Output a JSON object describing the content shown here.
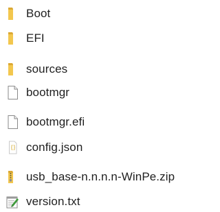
{
  "files": [
    {
      "name": "Boot",
      "icon": "folder-icon"
    },
    {
      "name": "EFI",
      "icon": "folder-icon"
    },
    {
      "name": "sources",
      "icon": "folder-icon"
    },
    {
      "name": "bootmgr",
      "icon": "file-icon"
    },
    {
      "name": "bootmgr.efi",
      "icon": "file-icon"
    },
    {
      "name": "config.json",
      "icon": "json-file-icon"
    },
    {
      "name": "usb_base-n.n.n.n-WinPe.zip",
      "icon": "zip-archive-icon"
    },
    {
      "name": "version.txt",
      "icon": "text-file-icon"
    }
  ],
  "colors": {
    "folder_body": "#f3c74e",
    "folder_tab": "#dba934",
    "file_outline": "#8a8a8a",
    "zip_accent": "#e0a92d",
    "text_file_pen": "#3f9a3c"
  }
}
